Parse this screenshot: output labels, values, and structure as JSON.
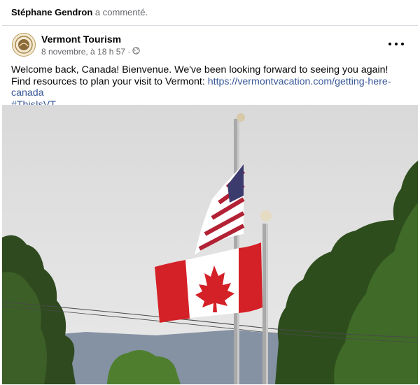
{
  "activity": {
    "actor": "Stéphane Gendron",
    "action": "a commenté."
  },
  "post": {
    "page_name": "Vermont Tourism",
    "timestamp": "8 novembre, à 18 h 57 ·",
    "privacy_icon": "globe-icon",
    "more_icon": "more-options-icon",
    "text": "Welcome back, Canada! Bienvenue. We've been looking forward to seeing you again! Find resources to plan your visit to Vermont:",
    "link": "https://vermontvacation.com/getting-here-canada",
    "hashtag": "#ThisIsVT"
  },
  "photo": {
    "subject": "Canadian and American flags on flagpoles between green trees under an overcast sky"
  },
  "colors": {
    "link": "#385898",
    "secondary_text": "#65676b",
    "divider": "#dadde1",
    "flag_red": "#d42027"
  }
}
